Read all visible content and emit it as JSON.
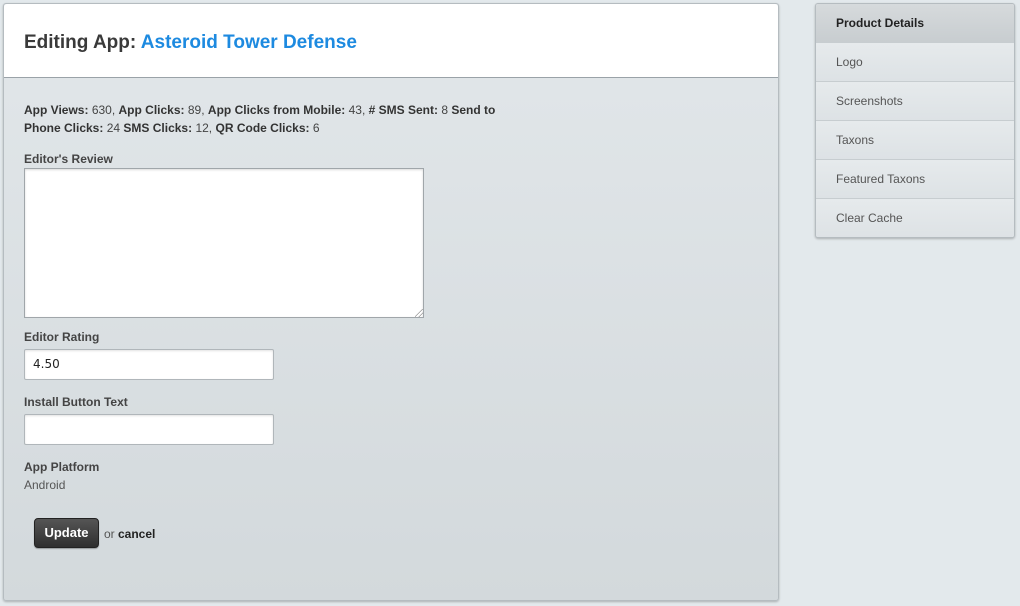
{
  "header": {
    "prefix": "Editing App:",
    "app_name": "Asteroid Tower Defense"
  },
  "stats": {
    "app_views_label": "App Views:",
    "app_views": "630,",
    "app_clicks_label": "App Clicks:",
    "app_clicks": "89,",
    "mobile_clicks_label": "App Clicks from Mobile:",
    "mobile_clicks": "43,",
    "sms_sent_label": "# SMS Sent:",
    "sms_sent": "8",
    "send_to_phone_label": "Send to Phone Clicks:",
    "send_to_phone": "24",
    "sms_clicks_label": "SMS Clicks:",
    "sms_clicks": "12,",
    "qr_clicks_label": "QR Code Clicks:",
    "qr_clicks": "6"
  },
  "form": {
    "review_label": "Editor's Review",
    "review_value": "",
    "rating_label": "Editor Rating",
    "rating_value": "4.50",
    "install_label": "Install Button Text",
    "install_value": "",
    "platform_label": "App Platform",
    "platform_value": "Android",
    "update_label": "Update",
    "or_text": "or",
    "cancel_label": "cancel"
  },
  "sidebar": {
    "items": [
      {
        "label": "Product Details",
        "active": true
      },
      {
        "label": "Logo"
      },
      {
        "label": "Screenshots"
      },
      {
        "label": "Taxons"
      },
      {
        "label": "Featured Taxons"
      },
      {
        "label": "Clear Cache"
      }
    ]
  }
}
